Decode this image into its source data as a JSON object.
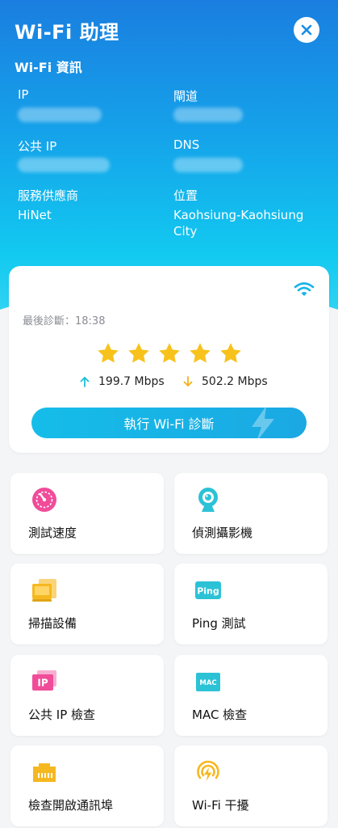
{
  "header": {
    "title": "Wi-Fi 助理",
    "close_icon": "close-icon"
  },
  "wifi_info": {
    "section_title": "Wi-Fi 資訊",
    "ip_label": "IP",
    "gateway_label": "閘道",
    "public_ip_label": "公共 IP",
    "dns_label": "DNS",
    "isp_label": "服務供應商",
    "isp_value": "HiNet",
    "location_label": "位置",
    "location_value": "Kaohsiung-Kaohsiung City"
  },
  "diagnosis": {
    "last_diagnosis": "最後診斷：18:38",
    "rating_stars": 5,
    "upload_speed": "199.7 Mbps",
    "download_speed": "502.2 Mbps",
    "run_button": "執行 Wi-Fi 診斷"
  },
  "tools": [
    {
      "label": "測試速度",
      "icon": "speedometer-icon"
    },
    {
      "label": "偵測攝影機",
      "icon": "camera-icon"
    },
    {
      "label": "掃描設備",
      "icon": "devices-icon"
    },
    {
      "label": "Ping 測試",
      "icon": "ping-icon"
    },
    {
      "label": "公共 IP 檢查",
      "icon": "ip-icon"
    },
    {
      "label": "MAC 檢查",
      "icon": "mac-icon"
    },
    {
      "label": "檢查開啟通訊埠",
      "icon": "ethernet-port-icon"
    },
    {
      "label": "Wi-Fi 干擾",
      "icon": "wifi-signal-icon"
    }
  ],
  "colors": {
    "accent": "#1ab3e8",
    "star": "#f7c21b",
    "upload_arrow": "#1bbfd8",
    "download_arrow": "#f3b21a",
    "pink": "#f04c9a",
    "teal": "#2cc2d6",
    "yellow": "#f6b820"
  }
}
